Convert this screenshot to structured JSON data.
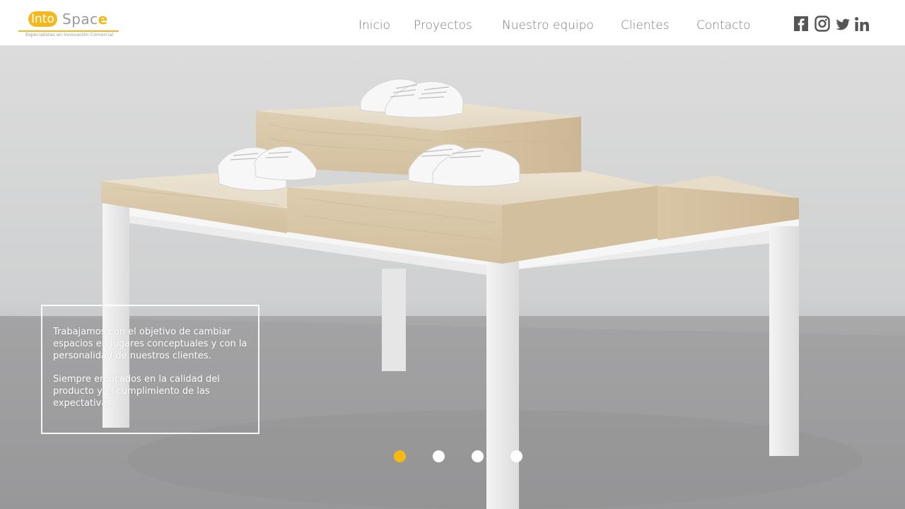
{
  "brand": {
    "into": "Into",
    "space_main": "Spac",
    "space_e": "e",
    "tagline": "Especialistas en Innovación Comercial",
    "accent_color": "#f3b81b"
  },
  "nav": {
    "items": [
      {
        "label": "Inicio"
      },
      {
        "label": "Proyectos"
      },
      {
        "label": "Nuestro equipo"
      },
      {
        "label": "Clientes"
      },
      {
        "label": "Contacto"
      }
    ]
  },
  "social": [
    {
      "icon": "facebook-icon"
    },
    {
      "icon": "instagram-icon"
    },
    {
      "icon": "twitter-icon"
    },
    {
      "icon": "linkedin-icon"
    }
  ],
  "hero": {
    "paragraph_1": "Trabajamos con el objetivo de cambiar espacios en lugares conceptuales y con la personalidad de nuestros clientes.",
    "paragraph_2": "Siempre enfocados en la calidad del producto y el cumplimiento de las expectativas."
  },
  "slider": {
    "active_index": 0,
    "slide_count": 4,
    "active_color": "#f5b914"
  }
}
